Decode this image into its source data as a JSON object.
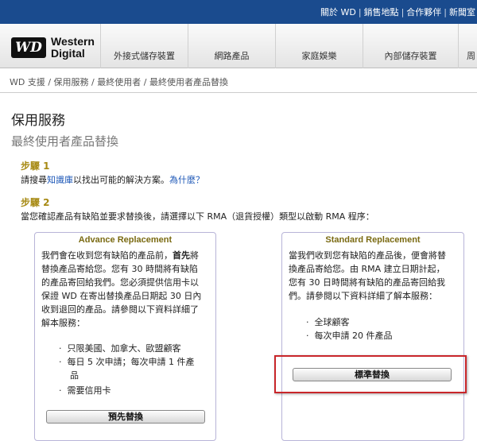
{
  "header": {
    "links": [
      "關於 WD",
      "銷售地點",
      "合作夥伴",
      "新聞室"
    ],
    "logo_badge": "WD",
    "logo_line1": "Western",
    "logo_line2": "Digital",
    "nav_tabs": [
      "外接式儲存裝置",
      "網路產品",
      "家庭娛樂",
      "內部儲存裝置",
      "周"
    ]
  },
  "breadcrumb": "WD 支援 / 保用服務 / 最終使用者 / 最終使用者產品替換",
  "main": {
    "title": "保用服務",
    "subtitle": "最終使用者產品替換",
    "step1": {
      "title": "步驟 1",
      "text_before": "請搜尋",
      "link1": "知識庫",
      "text_middle": "以找出可能的解決方案。",
      "link2": "為什麼？"
    },
    "step2": {
      "title": "步驟 2",
      "text": "當您確認產品有缺陷並要求替換後，請選擇以下 RMA（退貨授權）類型以啟動 RMA 程序："
    }
  },
  "advance": {
    "title": "Advance Replacement",
    "desc_line1_a": "我們會在收到您有缺陷的產品前，",
    "desc_line1_b": "首先",
    "desc_line1_c": "將",
    "desc_lines": [
      "替換產品寄給您。您有 30 時間將有缺陷",
      "的產品寄回給我們。您必須提供信用卡以",
      "保證 WD 在寄出替換產品日期起 30 日內",
      "收到退回的產品。請參閱以下資料詳細了",
      "解本服務："
    ],
    "bullets": [
      "只限美國、加拿大、歐盟顧客",
      "每日 5 次申請；每次申請 1 件產",
      "品",
      "需要信用卡"
    ],
    "button": "預先替換"
  },
  "standard": {
    "title": "Standard Replacement",
    "desc_lines": [
      "當我們收到您有缺陷的產品後，便會將替",
      "換產品寄給您。由 RMA 建立日期計起，",
      "您有 30 日時間將有缺陷的產品寄回給我",
      "們。請參閱以下資料詳細了解本服務："
    ],
    "bullets": [
      "全球顧客",
      "每次申請 20 件產品"
    ],
    "button": "標準替換"
  },
  "colors": {
    "topbar": "#1a4b8e",
    "step_title": "#a78a14",
    "link": "#1a55b6",
    "highlight": "#c8262a",
    "box_border": "#b8b4d8"
  }
}
